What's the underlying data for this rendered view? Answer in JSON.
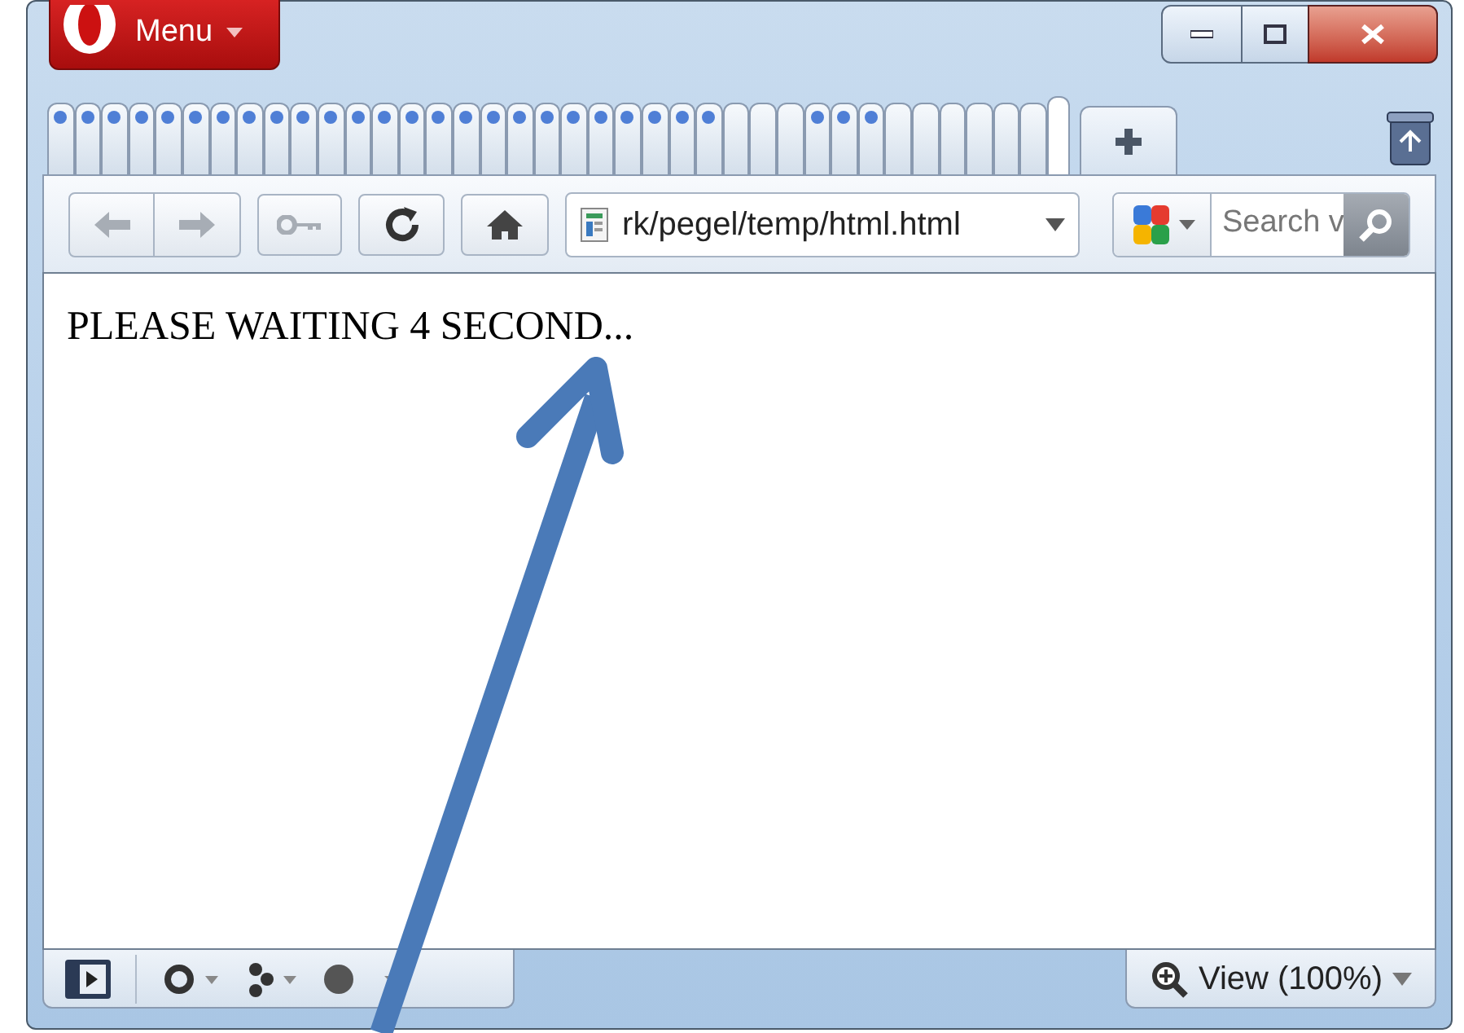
{
  "menu_button": {
    "label": "Menu"
  },
  "tabs": [
    {
      "loading": true,
      "selected": false
    },
    {
      "loading": true,
      "selected": false
    },
    {
      "loading": true,
      "selected": false
    },
    {
      "loading": true,
      "selected": false
    },
    {
      "loading": true,
      "selected": false
    },
    {
      "loading": true,
      "selected": false
    },
    {
      "loading": true,
      "selected": false
    },
    {
      "loading": true,
      "selected": false
    },
    {
      "loading": true,
      "selected": false
    },
    {
      "loading": true,
      "selected": false
    },
    {
      "loading": true,
      "selected": false
    },
    {
      "loading": true,
      "selected": false
    },
    {
      "loading": true,
      "selected": false
    },
    {
      "loading": true,
      "selected": false
    },
    {
      "loading": true,
      "selected": false
    },
    {
      "loading": true,
      "selected": false
    },
    {
      "loading": true,
      "selected": false
    },
    {
      "loading": true,
      "selected": false
    },
    {
      "loading": true,
      "selected": false
    },
    {
      "loading": true,
      "selected": false
    },
    {
      "loading": true,
      "selected": false
    },
    {
      "loading": true,
      "selected": false
    },
    {
      "loading": true,
      "selected": false
    },
    {
      "loading": true,
      "selected": false
    },
    {
      "loading": true,
      "selected": false
    },
    {
      "loading": false,
      "selected": false
    },
    {
      "loading": false,
      "selected": false
    },
    {
      "loading": false,
      "selected": false
    },
    {
      "loading": true,
      "selected": false
    },
    {
      "loading": true,
      "selected": false
    },
    {
      "loading": true,
      "selected": false
    },
    {
      "loading": false,
      "selected": false
    },
    {
      "loading": false,
      "selected": false
    },
    {
      "loading": false,
      "selected": false
    },
    {
      "loading": false,
      "selected": false
    },
    {
      "loading": false,
      "selected": false
    },
    {
      "loading": false,
      "selected": false
    },
    {
      "loading": false,
      "selected": true
    }
  ],
  "address": {
    "value": "rk/pegel/temp/html.html"
  },
  "search": {
    "placeholder": "Search v"
  },
  "page": {
    "text": "PLEASE WAITING 4 SECOND..."
  },
  "zoom_button": {
    "label": "View (100%)"
  }
}
